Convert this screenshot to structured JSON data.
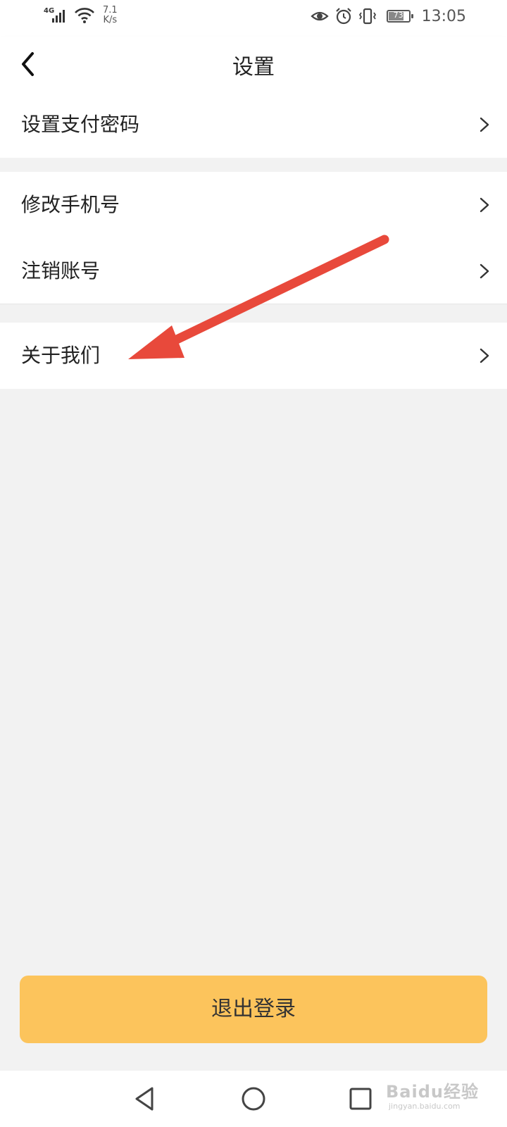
{
  "status_bar": {
    "network": "4G",
    "speed_value": "7.1",
    "speed_unit": "K/s",
    "battery_level": "73",
    "time": "13:05"
  },
  "nav": {
    "title": "设置",
    "back_icon": "chevron-left-icon"
  },
  "settings_groups": [
    {
      "items": [
        {
          "label": "设置支付密码",
          "icon": "chevron-right-icon"
        }
      ]
    },
    {
      "items": [
        {
          "label": "修改手机号",
          "icon": "chevron-right-icon"
        },
        {
          "label": "注销账号",
          "icon": "chevron-right-icon"
        }
      ]
    },
    {
      "items": [
        {
          "label": "关于我们",
          "icon": "chevron-right-icon"
        }
      ]
    }
  ],
  "logout_button": {
    "label": "退出登录",
    "color": "#fcc45c"
  },
  "annotation": {
    "color": "#e8493b"
  },
  "watermark": {
    "text": "Baidu经验",
    "sub": "jingyan.baidu.com"
  },
  "system_nav": {
    "back": "triangle-back-icon",
    "home": "circle-home-icon",
    "recents": "square-recents-icon"
  }
}
